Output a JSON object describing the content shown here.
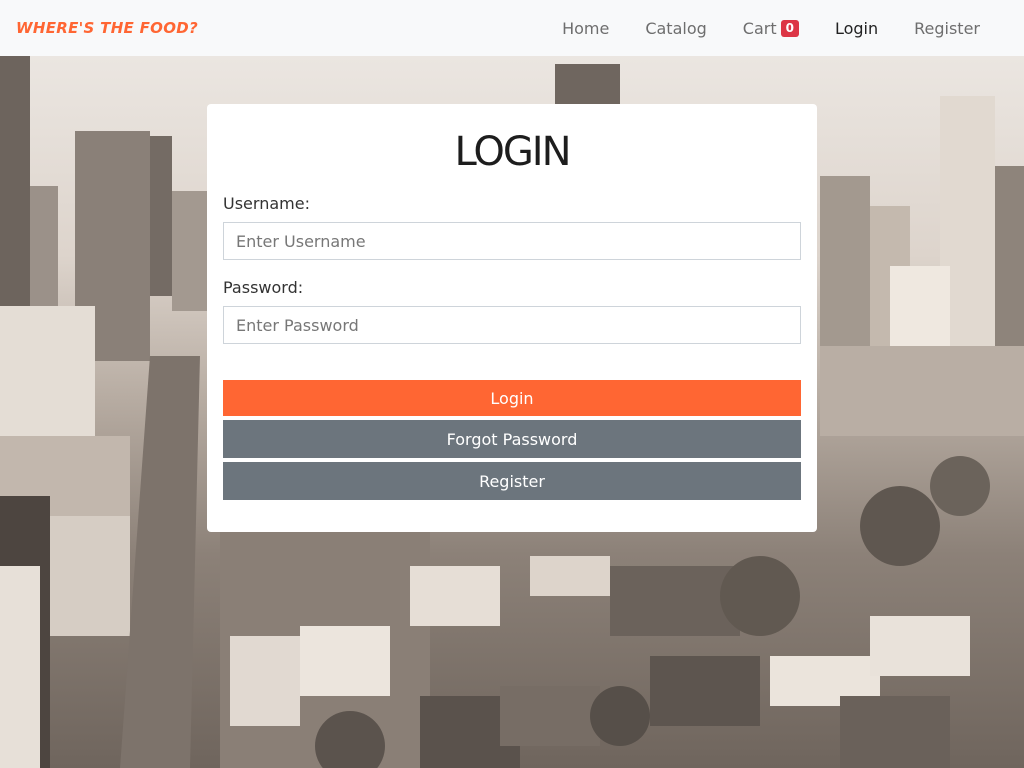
{
  "navbar": {
    "brand": "Where's the food?",
    "links": [
      {
        "label": "Home"
      },
      {
        "label": "Catalog"
      },
      {
        "label": "Cart",
        "badge": "0"
      },
      {
        "label": "Login"
      },
      {
        "label": "Register"
      }
    ],
    "active": "Login",
    "badge_color": "#dc3545",
    "brand_color": "#ff6633"
  },
  "login": {
    "title": "LOGIN",
    "username_label": "Username:",
    "username_placeholder": "Enter Username",
    "username_value": "",
    "password_label": "Password:",
    "password_placeholder": "Enter Password",
    "password_value": "",
    "login_button": "Login",
    "forgot_button": "Forgot Password",
    "register_button": "Register",
    "primary_color": "#ff6633",
    "secondary_color": "#6c757d"
  }
}
